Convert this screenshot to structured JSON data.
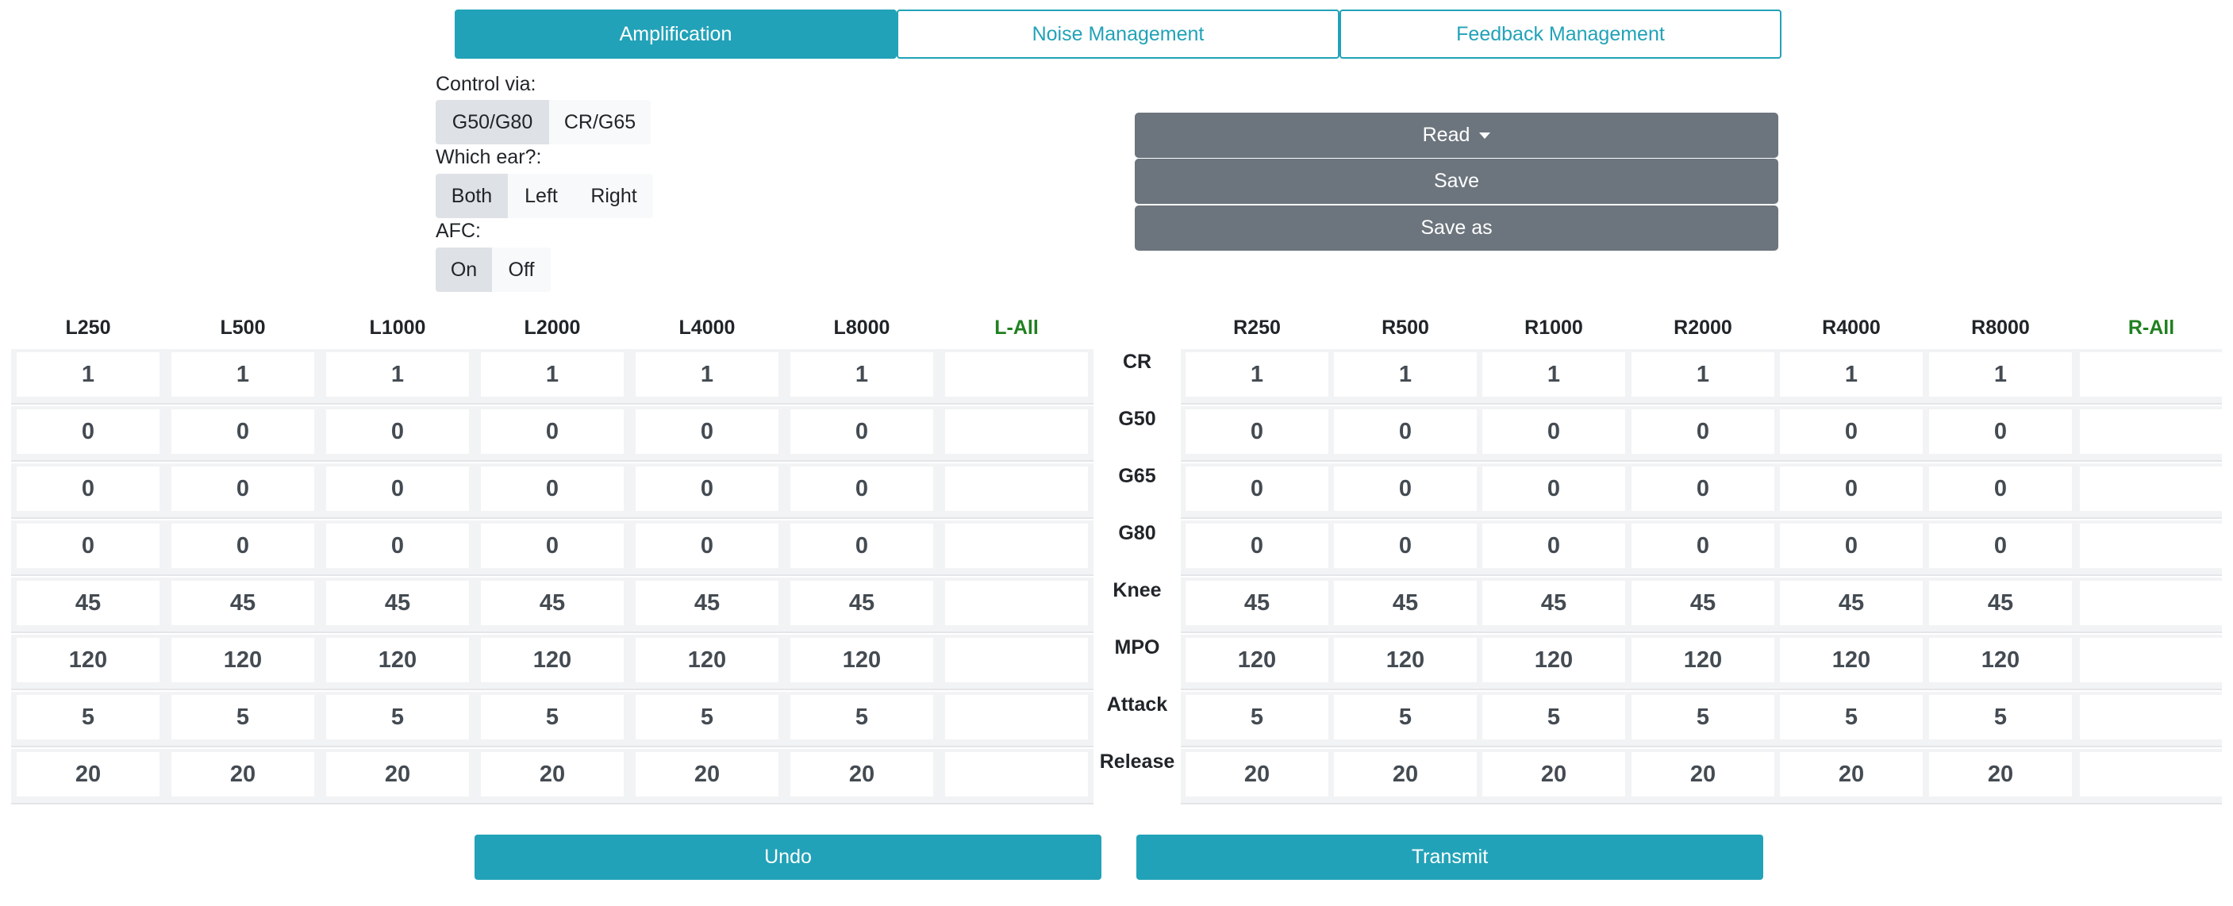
{
  "tabs": [
    {
      "label": "Amplification",
      "active": true
    },
    {
      "label": "Noise Management",
      "active": false
    },
    {
      "label": "Feedback Management",
      "active": false
    }
  ],
  "controls": {
    "control_via": {
      "label": "Control via:",
      "options": [
        "G50/G80",
        "CR/G65"
      ],
      "selected": "G50/G80"
    },
    "which_ear": {
      "label": "Which ear?:",
      "options": [
        "Both",
        "Left",
        "Right"
      ],
      "selected": "Both"
    },
    "afc": {
      "label": "AFC:",
      "options": [
        "On",
        "Off"
      ],
      "selected": "On"
    }
  },
  "actions": {
    "read": "Read",
    "save": "Save",
    "save_as": "Save as"
  },
  "left_headers": [
    "L250",
    "L500",
    "L1000",
    "L2000",
    "L4000",
    "L8000",
    "L-All"
  ],
  "right_headers": [
    "R250",
    "R500",
    "R1000",
    "R2000",
    "R4000",
    "R8000",
    "R-All"
  ],
  "row_labels": [
    "CR",
    "G50",
    "G65",
    "G80",
    "Knee",
    "MPO",
    "Attack",
    "Release"
  ],
  "left_values": [
    [
      "1",
      "1",
      "1",
      "1",
      "1",
      "1",
      ""
    ],
    [
      "0",
      "0",
      "0",
      "0",
      "0",
      "0",
      ""
    ],
    [
      "0",
      "0",
      "0",
      "0",
      "0",
      "0",
      ""
    ],
    [
      "0",
      "0",
      "0",
      "0",
      "0",
      "0",
      ""
    ],
    [
      "45",
      "45",
      "45",
      "45",
      "45",
      "45",
      ""
    ],
    [
      "120",
      "120",
      "120",
      "120",
      "120",
      "120",
      ""
    ],
    [
      "5",
      "5",
      "5",
      "5",
      "5",
      "5",
      ""
    ],
    [
      "20",
      "20",
      "20",
      "20",
      "20",
      "20",
      ""
    ]
  ],
  "right_values": [
    [
      "1",
      "1",
      "1",
      "1",
      "1",
      "1",
      ""
    ],
    [
      "0",
      "0",
      "0",
      "0",
      "0",
      "0",
      ""
    ],
    [
      "0",
      "0",
      "0",
      "0",
      "0",
      "0",
      ""
    ],
    [
      "0",
      "0",
      "0",
      "0",
      "0",
      "0",
      ""
    ],
    [
      "45",
      "45",
      "45",
      "45",
      "45",
      "45",
      ""
    ],
    [
      "120",
      "120",
      "120",
      "120",
      "120",
      "120",
      ""
    ],
    [
      "5",
      "5",
      "5",
      "5",
      "5",
      "5",
      ""
    ],
    [
      "20",
      "20",
      "20",
      "20",
      "20",
      "20",
      ""
    ]
  ],
  "bottom": {
    "undo": "Undo",
    "transmit": "Transmit"
  },
  "colors": {
    "accent": "#22a2b8",
    "action_gray": "#6c757d",
    "all_column": "#208020"
  }
}
